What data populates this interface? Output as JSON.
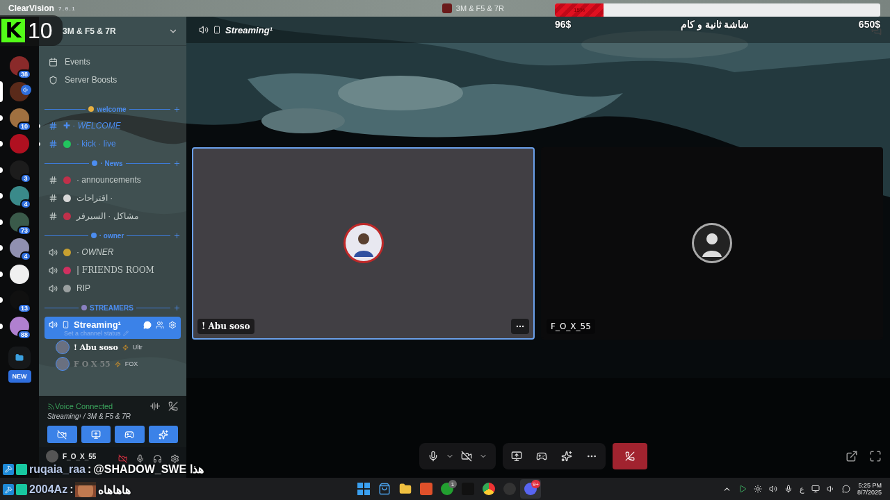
{
  "title_bar": {
    "app": "ClearVision",
    "version": "7.0.1",
    "server": "3M & F5 & 7R"
  },
  "donation_goal": {
    "percent": "15%",
    "level": 0.15,
    "raised": "96$",
    "title": "شاشة ثانية و كام",
    "goal": "650$"
  },
  "kick_overlay": {
    "logo": "K",
    "count": "10"
  },
  "servers": [
    {
      "color": "#8a2a2a",
      "badge": "38",
      "unread": false,
      "selected": false,
      "speaking": false
    },
    {
      "color": "#5a2a1a",
      "unread": false,
      "selected": true,
      "speaking": true
    },
    {
      "color": "#a07040",
      "badge": "10",
      "unread": true,
      "selected": false,
      "speaking": false
    },
    {
      "color": "#b01020",
      "unread": true,
      "selected": false,
      "speaking": false
    },
    {
      "color": "#1c1c1c",
      "badge": "3",
      "unread": true,
      "selected": false,
      "speaking": false
    },
    {
      "color": "#3a8a8a",
      "badge": "4",
      "unread": true,
      "selected": false,
      "speaking": false
    },
    {
      "color": "#3a5a4a",
      "badge": "73",
      "unread": true,
      "selected": false,
      "speaking": false
    },
    {
      "color": "#9090b0",
      "badge": "4",
      "unread": true,
      "selected": false,
      "speaking": false
    },
    {
      "color": "#f0f0f0",
      "unread": true,
      "selected": false,
      "speaking": false
    },
    {
      "color": "#101010",
      "badge": "13",
      "unread": true,
      "selected": false,
      "speaking": false
    },
    {
      "color": "#b080d0",
      "badge": "88",
      "unread": true,
      "selected": false,
      "speaking": false
    }
  ],
  "new_button": "NEW",
  "sidebar": {
    "server_name": "3M & F5 & 7R",
    "items": [
      {
        "kind": "link",
        "label": "Events"
      },
      {
        "kind": "link",
        "label": "Server Boosts"
      },
      {
        "kind": "category",
        "label": "welcome",
        "color": "#e8b040"
      },
      {
        "kind": "text",
        "label": "✚ · *WELCOME*",
        "unread": true
      },
      {
        "kind": "text",
        "label": "· kick · live",
        "unread": true,
        "color": "#22c55e"
      },
      {
        "kind": "category",
        "label": "· News",
        "color": "#4c8df0"
      },
      {
        "kind": "text",
        "label": "· announcements",
        "unread": false,
        "color": "#c0304a"
      },
      {
        "kind": "text",
        "label": "اقتراحات ·",
        "unread": false,
        "color": "#d8d8d8"
      },
      {
        "kind": "text",
        "label": "مشاكل · السيرفر",
        "unread": false,
        "color": "#c0304a"
      },
      {
        "kind": "category",
        "label": "· owner",
        "color": "#4c8df0"
      },
      {
        "kind": "voice",
        "label": "· *OWNER*",
        "selected": false,
        "color": "#c8a030"
      },
      {
        "kind": "voice",
        "label": "| FRIENDS ROOM",
        "selected": false,
        "color": "#d03060"
      },
      {
        "kind": "voice",
        "label": "RIP",
        "selected": false,
        "color": "#9aa0a0"
      },
      {
        "kind": "category",
        "label": "STREAMERS",
        "color": "#8a80c0"
      },
      {
        "kind": "voice",
        "label": "Streaming¹",
        "selected": true,
        "status": "Set a channel status",
        "members": [
          {
            "name": "! Abu soso",
            "tag": "Ultr"
          },
          {
            "name": "F O X 55",
            "tag": "FOX"
          }
        ]
      }
    ]
  },
  "voice_panel": {
    "status": "Voice Connected",
    "channel": "Streaming¹ / 3M & F5 & 7R"
  },
  "user_panel": {
    "name": "F_O_X_55"
  },
  "call": {
    "channel": "Streaming¹",
    "tiles": [
      {
        "name": "! Abu soso",
        "selected": true
      },
      {
        "name": "F_O_X_55",
        "selected": false
      }
    ]
  },
  "chat_overlay": [
    {
      "user": "ruqaia_raa",
      "separator": ":",
      "message": "@SHADOW_SWE هذا"
    },
    {
      "user": "2004Az",
      "separator": ":",
      "message": "هاهاهاه"
    }
  ],
  "taskbar": {
    "apps": [
      {
        "kind": "start",
        "selected": false
      },
      {
        "kind": "store",
        "selected": false
      },
      {
        "kind": "files",
        "selected": false
      },
      {
        "kind": "brave",
        "selected": false
      },
      {
        "kind": "xbox",
        "badge": "1",
        "selected": false
      },
      {
        "kind": "game",
        "selected": false
      },
      {
        "kind": "chrome",
        "selected": false
      },
      {
        "kind": "obs",
        "selected": false
      },
      {
        "kind": "discord",
        "badge": "9+",
        "selected": true
      }
    ],
    "language": "ع",
    "time": "5:25 PM",
    "date": "8/7/2025"
  }
}
